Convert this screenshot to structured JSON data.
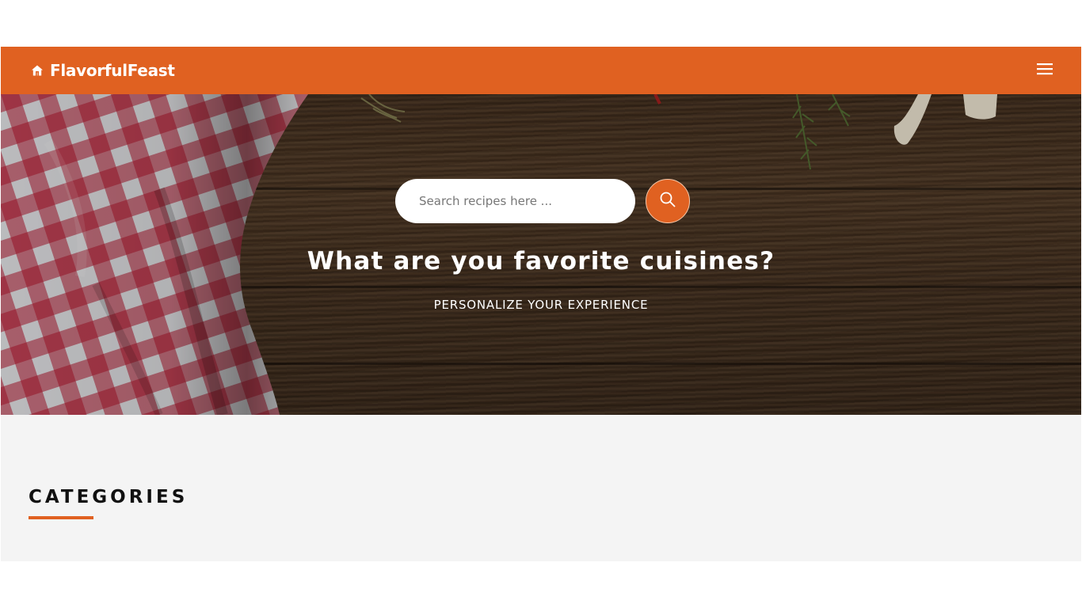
{
  "colors": {
    "accent": "#e06121",
    "section_background": "#f4f4f4",
    "text_light": "#ffffff",
    "text_dark": "#111111"
  },
  "navbar": {
    "brand_icon": "home-icon",
    "brand": "FlavorfulFeast",
    "menu_icon": "hamburger-menu-icon"
  },
  "hero": {
    "search": {
      "placeholder": "Search recipes here ...",
      "value": "",
      "button_icon": "search-icon"
    },
    "title": "What are you favorite cuisines?",
    "subtitle": "PERSONALIZE YOUR EXPERIENCE"
  },
  "categories": {
    "heading": "CATEGORIES"
  }
}
